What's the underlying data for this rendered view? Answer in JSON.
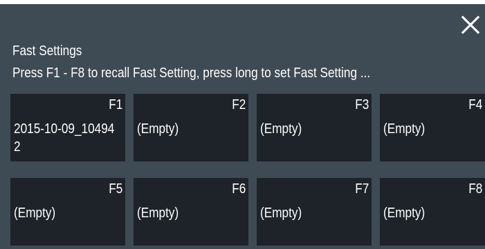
{
  "dialog": {
    "title": "Fast Settings",
    "subtitle": "Press F1 - F8 to recall Fast Setting, press long to set Fast Setting ...",
    "close_icon": "close-x-icon",
    "background_color": "#3e4a54",
    "slot_color": "#1e2329",
    "text_color": "#ffffff"
  },
  "slots": [
    {
      "key": "F1",
      "value": "2015-10-09_104942"
    },
    {
      "key": "F2",
      "value": "(Empty)"
    },
    {
      "key": "F3",
      "value": "(Empty)"
    },
    {
      "key": "F4",
      "value": "(Empty)"
    },
    {
      "key": "F5",
      "value": "(Empty)"
    },
    {
      "key": "F6",
      "value": "(Empty)"
    },
    {
      "key": "F7",
      "value": "(Empty)"
    },
    {
      "key": "F8",
      "value": "(Empty)"
    }
  ]
}
